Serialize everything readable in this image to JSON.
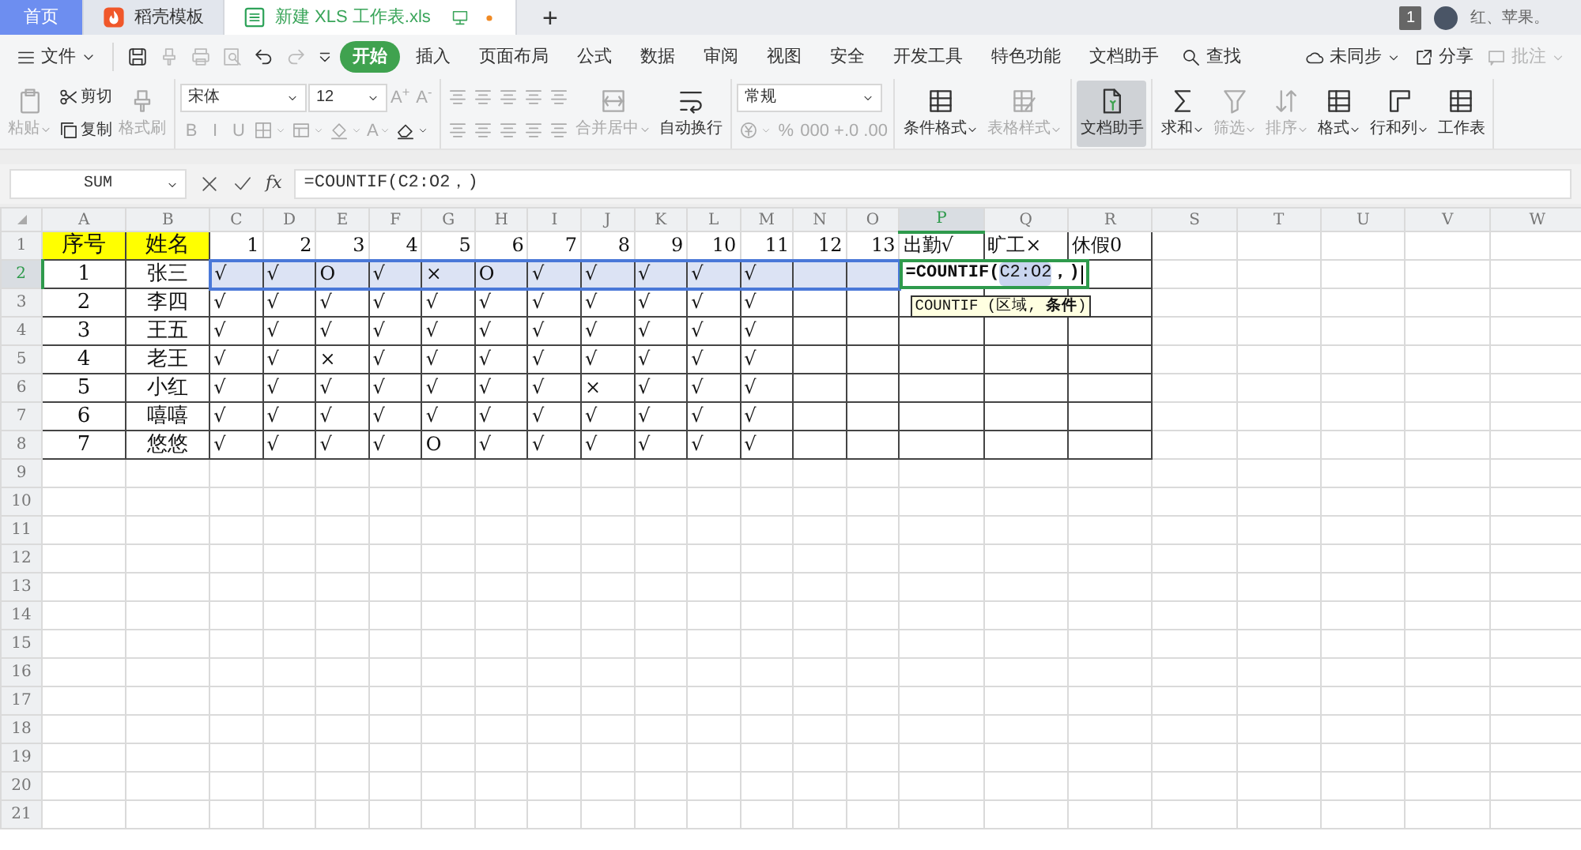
{
  "tabs": [
    {
      "label": "首页",
      "kind": "home",
      "selected": false
    },
    {
      "label": "稻壳模板",
      "kind": "docer",
      "selected": false
    },
    {
      "label": "新建 XLS 工作表.xls",
      "kind": "sheet",
      "selected": true,
      "unsaved": true
    }
  ],
  "new_tab": "+",
  "account": {
    "notifications": "1",
    "name": "红、苹果。"
  },
  "menu": {
    "file": "文件",
    "quick_access": [
      {
        "disabled": false
      },
      {
        "disabled": true
      },
      {
        "disabled": true
      },
      {
        "disabled": true
      },
      {
        "disabled": false
      },
      {
        "disabled": true
      }
    ],
    "tabs": [
      {
        "label": "开始",
        "selected": true
      },
      {
        "label": "插入",
        "selected": false
      },
      {
        "label": "页面布局",
        "selected": false
      },
      {
        "label": "公式",
        "selected": false
      },
      {
        "label": "数据",
        "selected": false
      },
      {
        "label": "审阅",
        "selected": false
      },
      {
        "label": "视图",
        "selected": false
      },
      {
        "label": "安全",
        "selected": false
      },
      {
        "label": "开发工具",
        "selected": false
      },
      {
        "label": "特色功能",
        "selected": false
      },
      {
        "label": "文档助手",
        "selected": false
      }
    ],
    "search": "查找",
    "actions": [
      {
        "label": "未同步",
        "disabled": false
      },
      {
        "label": "分享",
        "disabled": false
      },
      {
        "label": "批注",
        "disabled": true
      }
    ]
  },
  "ribbon": [
    {
      "columns": [
        {
          "kind": "large",
          "label": "粘贴",
          "disabled": true,
          "dropdown": true,
          "selected": false
        },
        {
          "kind": "stack",
          "lines": [
            [
              {
                "kind": "small",
                "label": "剪切",
                "disabled": false
              }
            ],
            [
              {
                "kind": "small",
                "label": "复制",
                "disabled": false
              }
            ]
          ]
        },
        {
          "kind": "large",
          "label": "格式刷",
          "disabled": true,
          "dropdown": false,
          "selected": false
        }
      ]
    },
    {
      "columns": [
        {
          "kind": "stack",
          "lines": [
            [
              {
                "kind": "field",
                "value": "宋体"
              },
              {
                "kind": "field",
                "value": "12"
              },
              {
                "kind": "glyph",
                "text": "A$^{+}$",
                "disabled": true,
                "dropdown": false
              },
              {
                "kind": "glyph",
                "text": "A$^{-}$",
                "disabled": true,
                "dropdown": false
              }
            ],
            [
              {
                "kind": "glyph",
                "text": "B",
                "disabled": true,
                "dropdown": false
              },
              {
                "kind": "glyph",
                "text": "I",
                "disabled": true,
                "dropdown": false
              },
              {
                "kind": "glyph",
                "text": "U",
                "disabled": true,
                "dropdown": false
              },
              {
                "kind": "icon",
                "disabled": true,
                "dropdown": true
              },
              {
                "kind": "icon",
                "disabled": true,
                "dropdown": true
              },
              {
                "kind": "icon",
                "disabled": true,
                "dropdown": true
              },
              {
                "kind": "glyph",
                "text": "A",
                "disabled": true,
                "dropdown": true
              },
              {
                "kind": "icon",
                "disabled": false,
                "dropdown": true
              }
            ]
          ]
        }
      ]
    },
    {
      "columns": [
        {
          "kind": "stack",
          "lines": [
            [
              {
                "kind": "icon",
                "disabled": true,
                "dropdown": false
              },
              {
                "kind": "icon",
                "disabled": true,
                "dropdown": false
              },
              {
                "kind": "icon",
                "disabled": true,
                "dropdown": false
              },
              {
                "kind": "icon",
                "disabled": true,
                "dropdown": false
              },
              {
                "kind": "icon",
                "disabled": true,
                "dropdown": false
              }
            ],
            [
              {
                "kind": "icon",
                "disabled": true,
                "dropdown": false
              },
              {
                "kind": "icon",
                "disabled": true,
                "dropdown": false
              },
              {
                "kind": "icon",
                "disabled": true,
                "dropdown": false
              },
              {
                "kind": "icon",
                "disabled": true,
                "dropdown": false
              },
              {
                "kind": "icon",
                "disabled": true,
                "dropdown": false
              }
            ]
          ]
        },
        {
          "kind": "large",
          "label": "合并居中",
          "disabled": true,
          "dropdown": true,
          "selected": false
        },
        {
          "kind": "large",
          "label": "自动换行",
          "disabled": false,
          "dropdown": false,
          "selected": false
        }
      ]
    },
    {
      "columns": [
        {
          "kind": "stack",
          "lines": [
            [
              {
                "kind": "field",
                "value": "常规"
              }
            ],
            [
              {
                "kind": "icon",
                "disabled": true,
                "dropdown": true
              },
              {
                "kind": "glyph",
                "text": "%",
                "disabled": true,
                "dropdown": false
              },
              {
                "kind": "glyph",
                "text": "000",
                "disabled": true,
                "dropdown": false
              },
              {
                "kind": "glyph",
                "text": "+.0",
                "disabled": true,
                "dropdown": false
              },
              {
                "kind": "glyph",
                "text": ".00",
                "disabled": true,
                "dropdown": false
              }
            ]
          ]
        }
      ]
    },
    {
      "columns": [
        {
          "kind": "large",
          "label": "条件格式",
          "disabled": false,
          "dropdown": true,
          "selected": false
        },
        {
          "kind": "large",
          "label": "表格样式",
          "disabled": true,
          "dropdown": true,
          "selected": false
        }
      ]
    },
    {
      "columns": [
        {
          "kind": "large",
          "label": "文档助手",
          "disabled": false,
          "dropdown": false,
          "selected": true
        }
      ]
    },
    {
      "columns": [
        {
          "kind": "large",
          "label": "求和",
          "disabled": false,
          "dropdown": true,
          "selected": false
        },
        {
          "kind": "large",
          "label": "筛选",
          "disabled": true,
          "dropdown": true,
          "selected": false
        },
        {
          "kind": "large",
          "label": "排序",
          "disabled": true,
          "dropdown": true,
          "selected": false
        },
        {
          "kind": "large",
          "label": "格式",
          "disabled": false,
          "dropdown": true,
          "selected": false
        },
        {
          "kind": "large",
          "label": "行和列",
          "disabled": false,
          "dropdown": true,
          "selected": false
        },
        {
          "kind": "large",
          "label": "工作表",
          "disabled": false,
          "dropdown": false,
          "selected": false
        }
      ]
    }
  ],
  "formula_bar": {
    "name_box": "SUM",
    "fx": "fx",
    "formula": "=COUNTIF(C2:O2，)"
  },
  "sheet": {
    "columns": [
      {
        "label": "A",
        "selected": false,
        "in_range": false
      },
      {
        "label": "B",
        "selected": false,
        "in_range": false
      },
      {
        "label": "C",
        "selected": false,
        "in_range": true
      },
      {
        "label": "D",
        "selected": false,
        "in_range": true
      },
      {
        "label": "E",
        "selected": false,
        "in_range": true
      },
      {
        "label": "F",
        "selected": false,
        "in_range": true
      },
      {
        "label": "G",
        "selected": false,
        "in_range": true
      },
      {
        "label": "H",
        "selected": false,
        "in_range": true
      },
      {
        "label": "I",
        "selected": false,
        "in_range": true
      },
      {
        "label": "J",
        "selected": false,
        "in_range": true
      },
      {
        "label": "K",
        "selected": false,
        "in_range": true
      },
      {
        "label": "L",
        "selected": false,
        "in_range": true
      },
      {
        "label": "M",
        "selected": false,
        "in_range": true
      },
      {
        "label": "N",
        "selected": false,
        "in_range": true
      },
      {
        "label": "O",
        "selected": false,
        "in_range": true
      },
      {
        "label": "P",
        "selected": true,
        "in_range": false
      },
      {
        "label": "Q",
        "selected": false,
        "in_range": false
      },
      {
        "label": "R",
        "selected": false,
        "in_range": false
      },
      {
        "label": "S",
        "selected": false,
        "in_range": false
      },
      {
        "label": "T",
        "selected": false,
        "in_range": false
      },
      {
        "label": "U",
        "selected": false,
        "in_range": false
      },
      {
        "label": "V",
        "selected": false,
        "in_range": false
      },
      {
        "label": "W",
        "selected": false,
        "in_range": false
      }
    ],
    "rows": [
      {
        "label": "1",
        "selected": false,
        "cells": [
          {
            "text": "序号",
            "highlight": true,
            "right_aligned": false
          },
          {
            "text": "姓名",
            "highlight": true,
            "right_aligned": false
          },
          {
            "text": "1",
            "highlight": false,
            "right_aligned": true
          },
          {
            "text": "2",
            "highlight": false,
            "right_aligned": true
          },
          {
            "text": "3",
            "highlight": false,
            "right_aligned": true
          },
          {
            "text": "4",
            "highlight": false,
            "right_aligned": true
          },
          {
            "text": "5",
            "highlight": false,
            "right_aligned": true
          },
          {
            "text": "6",
            "highlight": false,
            "right_aligned": true
          },
          {
            "text": "7",
            "highlight": false,
            "right_aligned": true
          },
          {
            "text": "8",
            "highlight": false,
            "right_aligned": true
          },
          {
            "text": "9",
            "highlight": false,
            "right_aligned": true
          },
          {
            "text": "10",
            "highlight": false,
            "right_aligned": true
          },
          {
            "text": "11",
            "highlight": false,
            "right_aligned": true
          },
          {
            "text": "12",
            "highlight": false,
            "right_aligned": true
          },
          {
            "text": "13",
            "highlight": false,
            "right_aligned": true
          },
          {
            "text": "出勤√",
            "highlight": false,
            "right_aligned": false
          },
          {
            "text": "旷工×",
            "highlight": false,
            "right_aligned": false
          },
          {
            "text": "休假0",
            "highlight": false,
            "right_aligned": false
          }
        ]
      },
      {
        "label": "2",
        "selected": true,
        "cells": [
          "1",
          "张三",
          "√",
          "√",
          "O",
          "√",
          "×",
          "O",
          "√",
          "√",
          "√",
          "√",
          "√",
          null,
          null,
          {
            "kind": "editor",
            "prefix": "=COUNTIF(",
            "reference": "C2:O2",
            "suffix": "，)"
          },
          null,
          null
        ]
      },
      {
        "label": "3",
        "selected": false,
        "cells": [
          "2",
          "李四",
          "√",
          "√",
          "√",
          "√",
          "√",
          "√",
          "√",
          "√",
          "√",
          "√",
          "√",
          null,
          null,
          null,
          null,
          null
        ]
      },
      {
        "label": "4",
        "selected": false,
        "cells": [
          "3",
          "王五",
          "√",
          "√",
          "√",
          "√",
          "√",
          "√",
          "√",
          "√",
          "√",
          "√",
          "√",
          null,
          null,
          null,
          null,
          null
        ]
      },
      {
        "label": "5",
        "selected": false,
        "cells": [
          "4",
          "老王",
          "√",
          "√",
          "×",
          "√",
          "√",
          "√",
          "√",
          "√",
          "√",
          "√",
          "√",
          null,
          null,
          null,
          null,
          null
        ]
      },
      {
        "label": "6",
        "selected": false,
        "cells": [
          "5",
          "小红",
          "√",
          "√",
          "√",
          "√",
          "√",
          "√",
          "√",
          "×",
          "√",
          "√",
          "√",
          null,
          null,
          null,
          null,
          null
        ]
      },
      {
        "label": "7",
        "selected": false,
        "cells": [
          "6",
          "嘻嘻",
          "√",
          "√",
          "√",
          "√",
          "√",
          "√",
          "√",
          "√",
          "√",
          "√",
          "√",
          null,
          null,
          null,
          null,
          null
        ]
      },
      {
        "label": "8",
        "selected": false,
        "cells": [
          "7",
          "悠悠",
          "√",
          "√",
          "√",
          "√",
          "O",
          "√",
          "√",
          "√",
          "√",
          "√",
          "√",
          null,
          null,
          null,
          null,
          null
        ]
      },
      {
        "label": "9",
        "selected": false,
        "cells": []
      },
      {
        "label": "10",
        "selected": false,
        "cells": []
      },
      {
        "label": "11",
        "selected": false,
        "cells": []
      },
      {
        "label": "12",
        "selected": false,
        "cells": []
      },
      {
        "label": "13",
        "selected": false,
        "cells": []
      },
      {
        "label": "14",
        "selected": false,
        "cells": []
      },
      {
        "label": "15",
        "selected": false,
        "cells": []
      },
      {
        "label": "16",
        "selected": false,
        "cells": []
      },
      {
        "label": "17",
        "selected": false,
        "cells": []
      },
      {
        "label": "18",
        "selected": false,
        "cells": []
      },
      {
        "label": "19",
        "selected": false,
        "cells": []
      },
      {
        "label": "20",
        "selected": false,
        "cells": []
      },
      {
        "label": "21",
        "selected": false,
        "cells": []
      }
    ],
    "tooltip": "COUNTIF (区域, **条件**)"
  }
}
